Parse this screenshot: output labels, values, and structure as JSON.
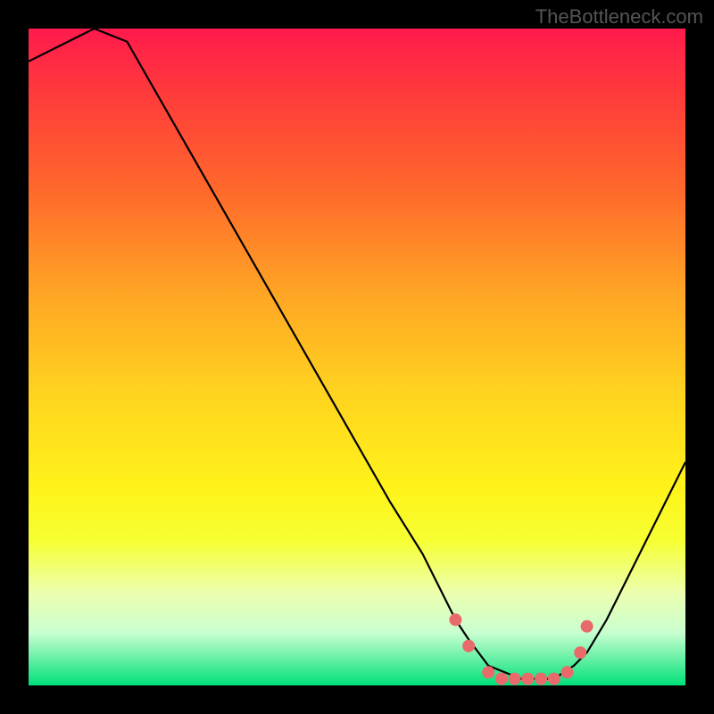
{
  "watermark": "TheBottleneck.com",
  "chart_data": {
    "type": "line",
    "title": "",
    "xlabel": "",
    "ylabel": "",
    "xlim": [
      0,
      100
    ],
    "ylim": [
      0,
      100
    ],
    "grid": false,
    "legend": false,
    "series": [
      {
        "name": "curve",
        "x": [
          0,
          10,
          15,
          55,
          60,
          65,
          67,
          70,
          75,
          80,
          83,
          85,
          88,
          100
        ],
        "y": [
          95,
          100,
          98,
          28,
          20,
          10,
          7,
          3,
          1,
          1,
          3,
          5,
          10,
          34
        ]
      }
    ],
    "markers": {
      "name": "highlight-points",
      "x": [
        65,
        67,
        70,
        72,
        74,
        76,
        78,
        80,
        82,
        84,
        85
      ],
      "y": [
        10,
        6,
        2,
        1,
        1,
        1,
        1,
        1,
        2,
        5,
        9
      ]
    },
    "background": "red-yellow-green vertical gradient (red top, green bottom)"
  }
}
